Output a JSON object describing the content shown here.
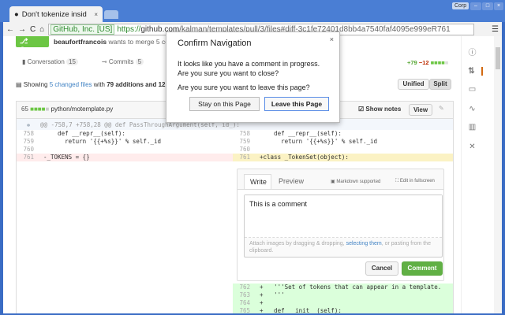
{
  "browser": {
    "tab_title": "Don't tokenize insid",
    "url_ev": "GitHub, Inc. [US]",
    "url_prefix": "https://",
    "url_host": "github.com",
    "url_path": "/kalman/templates/pull/3/files#diff-3c1fe72401d8bb4a7540faf4095e999eR761",
    "profile": "Corp"
  },
  "pr": {
    "state": "Open",
    "author": "beaufortfrancois",
    "summary": "wants to merge 5 co",
    "tabs": [
      {
        "label": "Conversation",
        "count": "15"
      },
      {
        "label": "Commits",
        "count": "5"
      }
    ],
    "additions": "+79",
    "deletions": "−12",
    "showing_prefix": "Showing",
    "changed_files": "5 changed files",
    "with": "with",
    "additions_text": "79 additions",
    "and": "and 12",
    "unified": "Unified",
    "split": "Split"
  },
  "file": {
    "count": "65",
    "path": "python/motemplate.py",
    "show_notes": "Show notes",
    "view": "View"
  },
  "diff": {
    "hunk": "@@ -758,7 +758,28 @@ def PassThroughArgument(self, id_):",
    "left": [
      {
        "n": "758",
        "code": "    def __repr__(self):"
      },
      {
        "n": "759",
        "code": "      return '{{+%s}}' % self._id"
      },
      {
        "n": "760",
        "code": ""
      },
      {
        "n": "761",
        "code": "-_TOKENS = {}"
      }
    ],
    "right": [
      {
        "n": "758",
        "code": "    def __repr__(self):"
      },
      {
        "n": "759",
        "code": "      return '{{+%s}}' % self._id"
      },
      {
        "n": "760",
        "code": ""
      },
      {
        "n": "761",
        "code": "+class _TokenSet(object):"
      }
    ],
    "added": [
      {
        "n": "762",
        "code": "+   '''Set of tokens that can appear in a template."
      },
      {
        "n": "763",
        "code": "+   '''"
      },
      {
        "n": "764",
        "code": "+"
      },
      {
        "n": "765",
        "code": "+   def __init__(self):"
      }
    ]
  },
  "comment": {
    "write": "Write",
    "preview": "Preview",
    "markdown": "Markdown supported",
    "fullscreen": "Edit in fullscreen",
    "value": "This is a comment",
    "attach1": "Attach images by dragging & dropping, ",
    "attach_link": "selecting them",
    "attach2": ", or pasting from the clipboard.",
    "cancel": "Cancel",
    "submit": "Comment"
  },
  "dialog": {
    "title": "Confirm Navigation",
    "line1": "It looks like you have a comment in progress.",
    "line2": "Are you sure you want to close?",
    "line3": "Are you sure you want to leave this page?",
    "stay": "Stay on this Page",
    "leave": "Leave this Page",
    "close": "×"
  }
}
